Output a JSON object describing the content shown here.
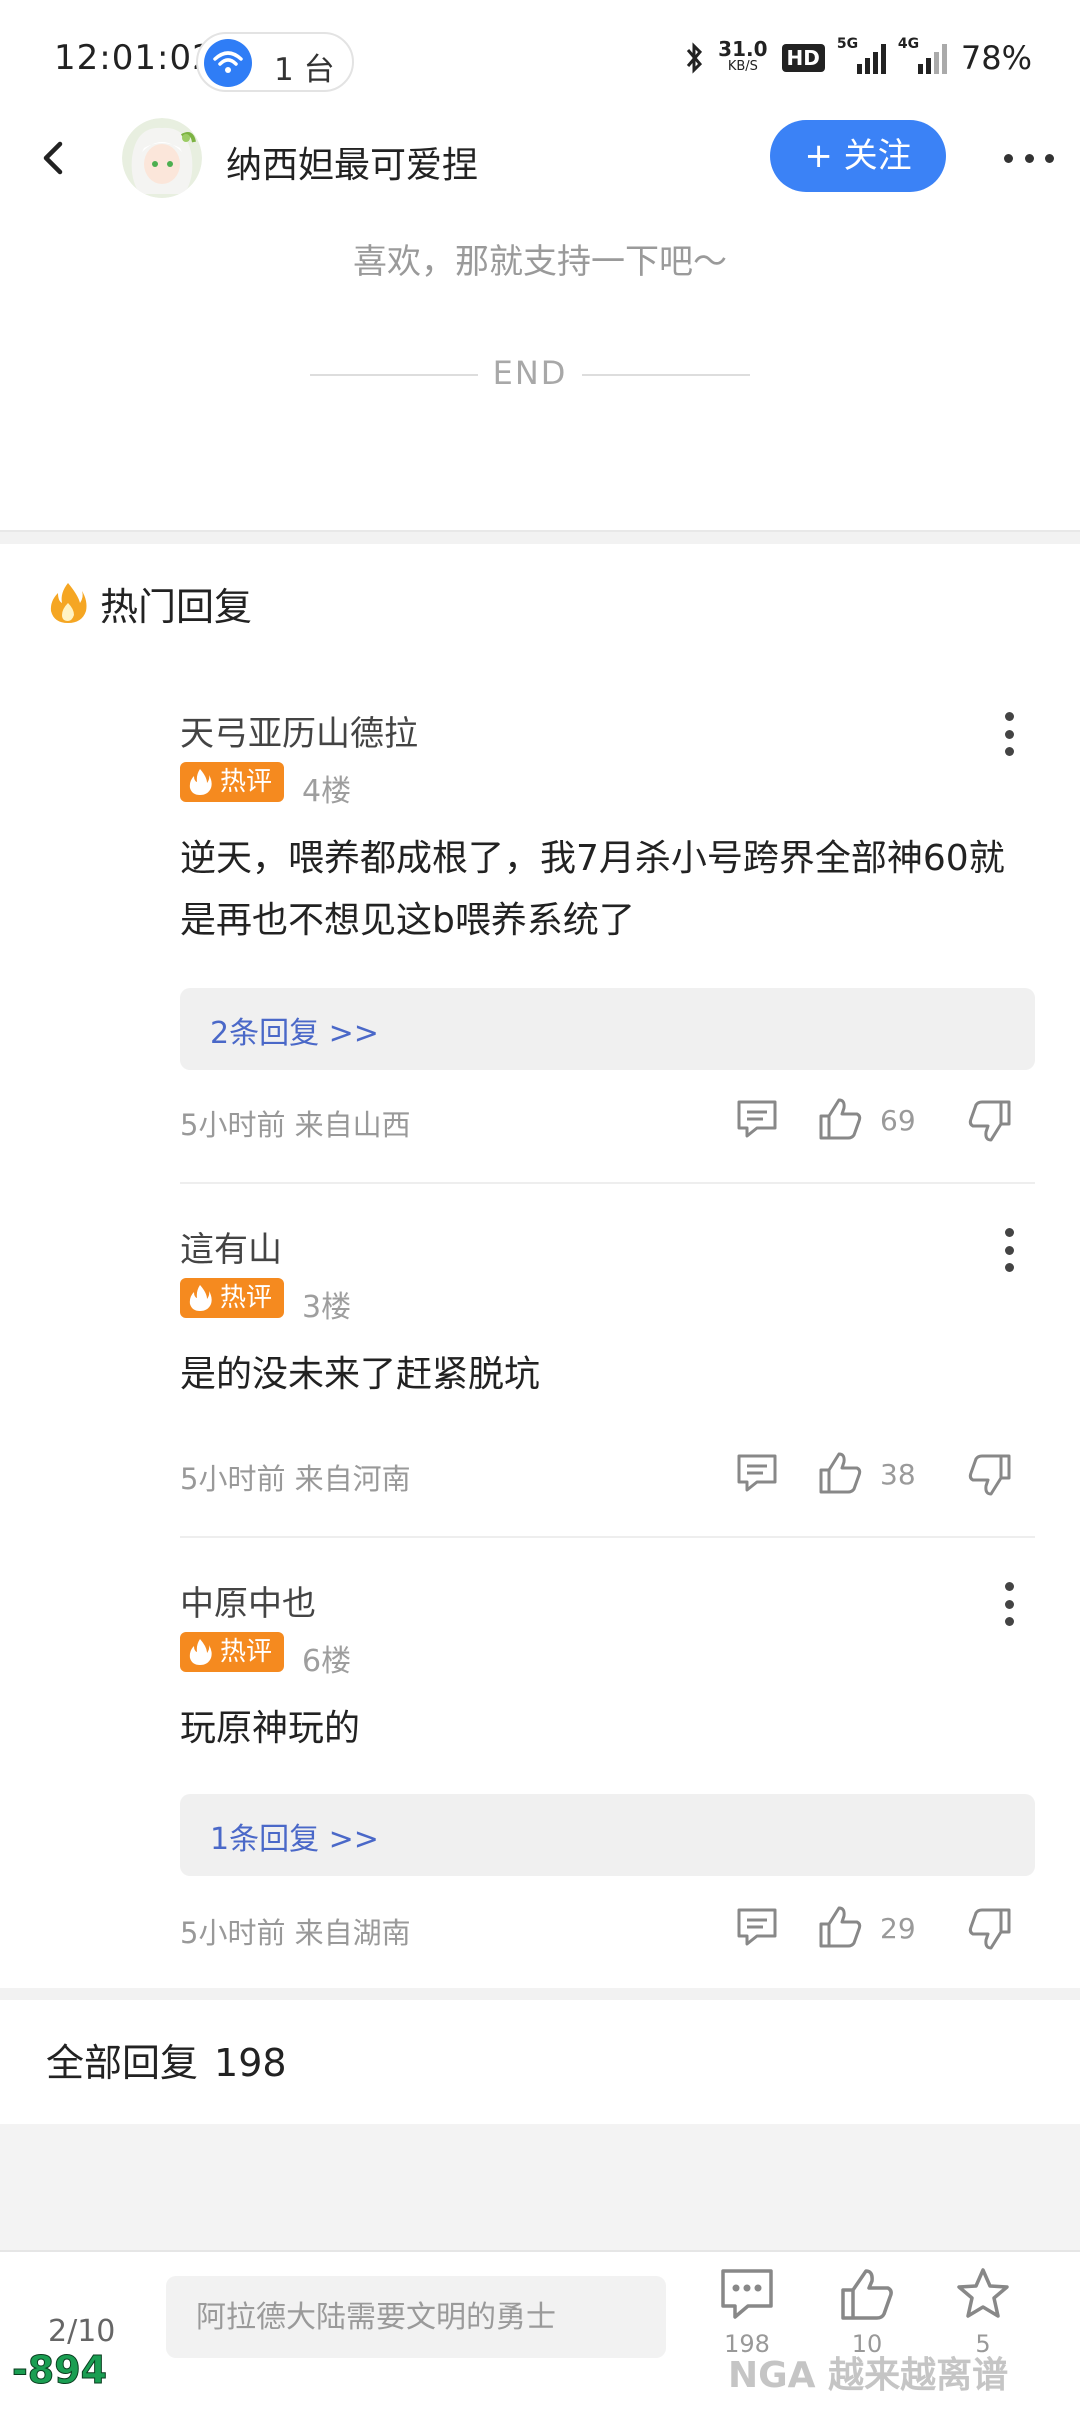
{
  "status_bar": {
    "time": "12:01:02",
    "hotspot_count": "1 台",
    "net_speed": "31.0",
    "net_speed_unit": "KB/S",
    "hd_label": "HD",
    "signal_1": "5G",
    "signal_2": "4G",
    "battery": "78%"
  },
  "header": {
    "author_name": "纳西妲最可爱捏",
    "follow_label": "+ 关注"
  },
  "post_footer": {
    "support_text": "喜欢，那就支持一下吧～",
    "end_text": "END"
  },
  "hot_replies": {
    "title": "热门回复",
    "badge_label": "热评",
    "items": [
      {
        "name": "天弓亚历山德拉",
        "floor": "4楼",
        "body": "逆天，喂养都成根了，我7月杀小号跨界全部神60就是再也不想见这b喂养系统了",
        "replies_link": "2条回复 >>",
        "meta": "5小时前 来自山西",
        "likes": "69"
      },
      {
        "name": "這有山",
        "floor": "3楼",
        "body": "是的没未来了赶紧脱坑",
        "replies_link": "",
        "meta": "5小时前 来自河南",
        "likes": "38"
      },
      {
        "name": "中原中也",
        "floor": "6楼",
        "body": "玩原神玩的",
        "replies_link": "1条回复 >>",
        "meta": "5小时前 来自湖南",
        "likes": "29"
      }
    ]
  },
  "all_replies": {
    "label": "全部回复",
    "count": "198"
  },
  "bottom_bar": {
    "page_indicator": "2/10",
    "input_placeholder": "阿拉德大陆需要文明的勇士",
    "comment_count": "198",
    "like_count": "10",
    "star_count": "5"
  },
  "watermarks": {
    "left": "-894",
    "right": "NGA 越来越离谱"
  },
  "colors": {
    "accent_blue": "#3b82f6",
    "hot_orange": "#f58a1f",
    "link_blue": "#4a68c8"
  }
}
